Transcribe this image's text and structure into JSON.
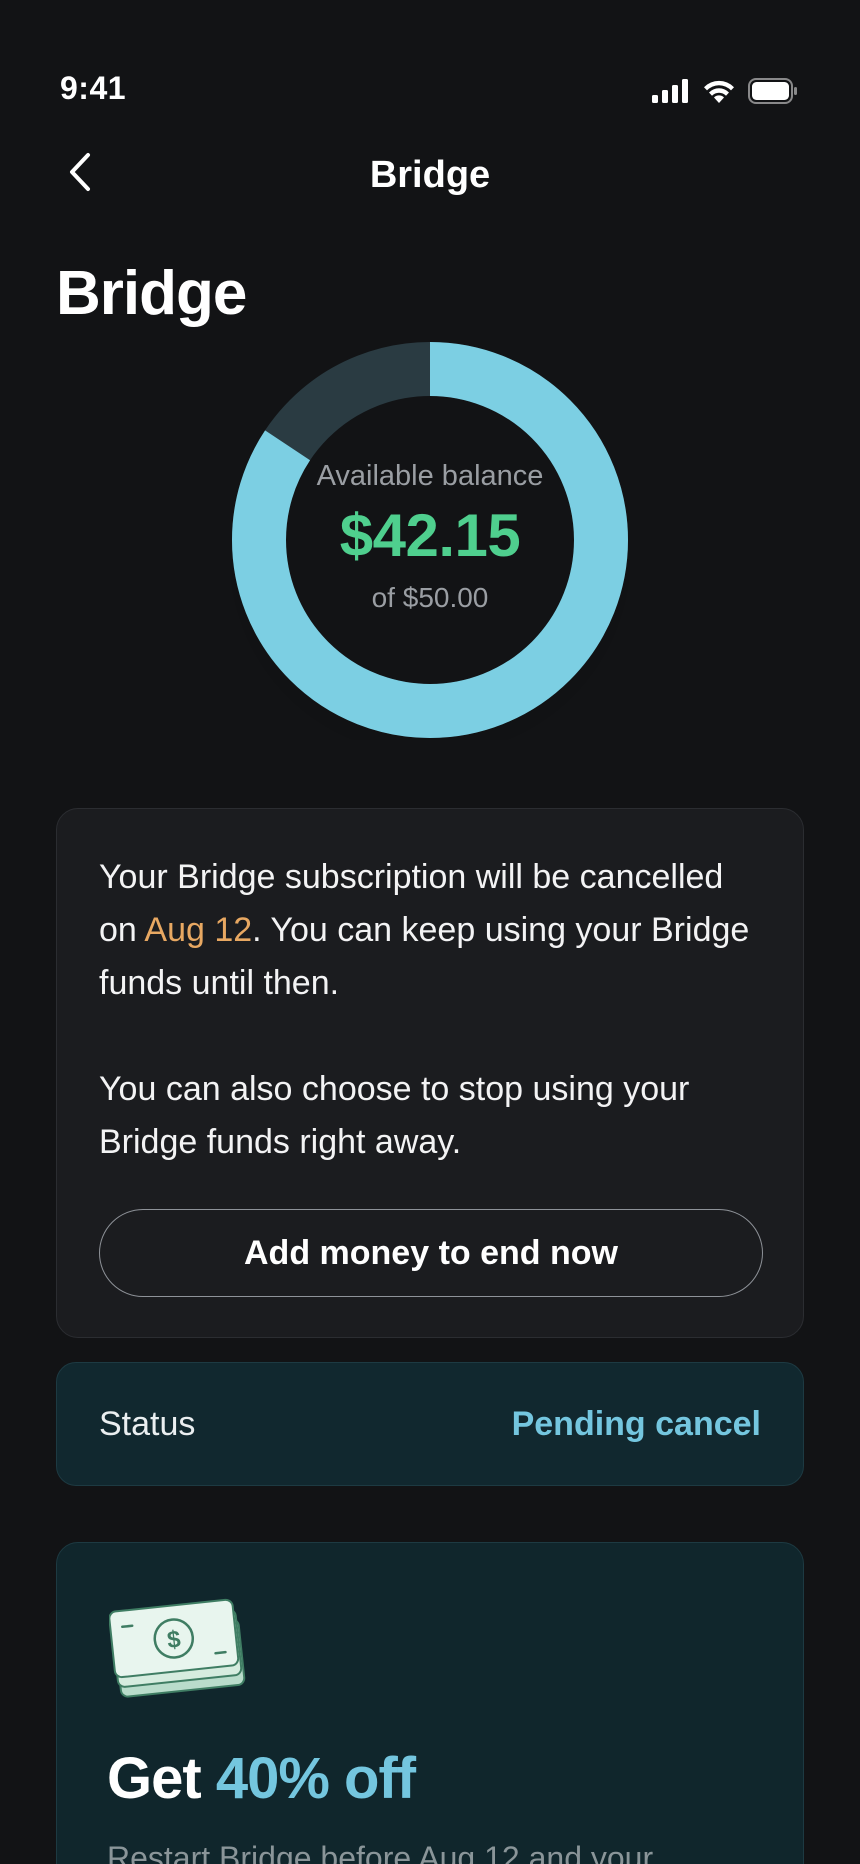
{
  "status_bar": {
    "time": "9:41"
  },
  "nav": {
    "title": "Bridge"
  },
  "header": {
    "large_title": "Bridge"
  },
  "balance": {
    "caption": "Available balance",
    "amount": "$42.15",
    "total": "of $50.00",
    "fraction": 0.843,
    "ring_color": "#7ccfe3",
    "amount_color": "#4fcf8e"
  },
  "notice": {
    "p1_start": "Your Bridge subscription will be cancelled on ",
    "p1_date": "Aug 12",
    "p1_end": ". You can keep using your Bridge funds until then.",
    "p2": "You can also choose to stop using your Bridge funds right away.",
    "button_label": "Add money to end now"
  },
  "status": {
    "label": "Status",
    "value": "Pending cancel"
  },
  "promo": {
    "title_prefix": "Get ",
    "title_accent": "40% off",
    "body": "Restart Bridge before Aug 12 and your",
    "icon": "cash-stack-icon"
  },
  "colors": {
    "accent": "#74c6df",
    "highlight": "#e8a862",
    "background": "#121315"
  }
}
